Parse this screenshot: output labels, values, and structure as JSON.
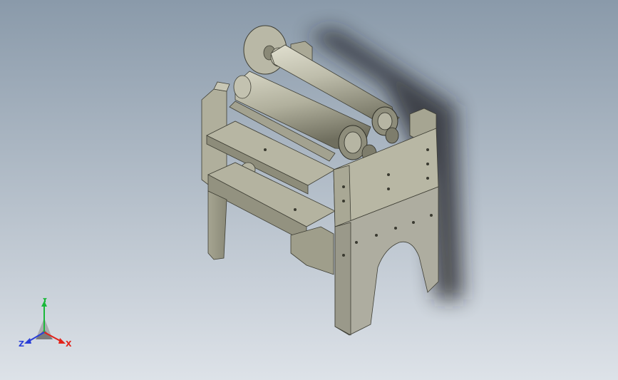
{
  "viewport": {
    "bg_top": "#8a9aaa",
    "bg_bottom": "#dde2e8"
  },
  "colors": {
    "metal_light": "#c6c4b2",
    "metal_mid": "#a9a893",
    "metal_dark": "#7f7e6c",
    "metal_edge": "#3e3e34",
    "roller_light": "#d2d1c0",
    "roller_dark": "#8f8e7d",
    "shadow": "#1f2124",
    "x_axis": "#e2231a",
    "y_axis": "#1ab83a",
    "z_axis": "#2a3fd8"
  },
  "triad": {
    "x_label": "X",
    "y_label": "Y",
    "z_label": "Z"
  }
}
